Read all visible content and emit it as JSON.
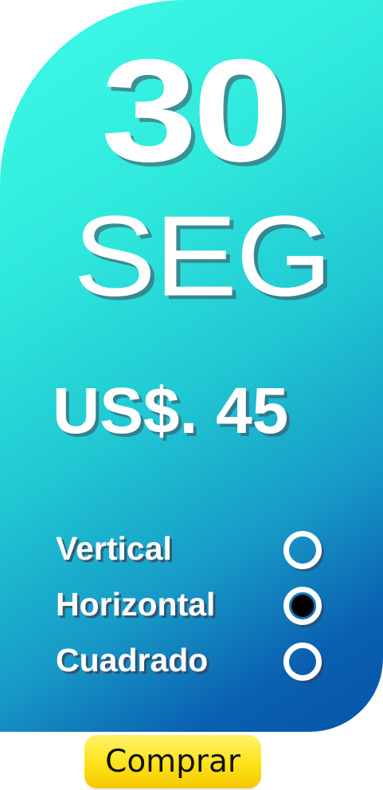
{
  "plan": {
    "duration_number": "30",
    "duration_unit": "SEG",
    "price": "US$. 45"
  },
  "format_options": [
    {
      "label": "Vertical",
      "selected": false
    },
    {
      "label": "Horizontal",
      "selected": true
    },
    {
      "label": "Cuadrado",
      "selected": false
    }
  ],
  "buy_button": {
    "label": "Comprar"
  },
  "colors": {
    "gradient_start": "#3ffbe6",
    "gradient_end": "#0656a8",
    "button": "#fde21a",
    "text": "#ffffff"
  }
}
